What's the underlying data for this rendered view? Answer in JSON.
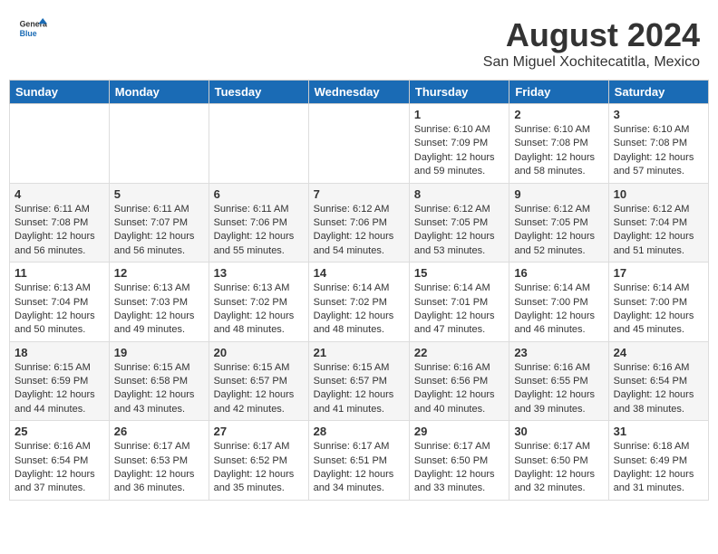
{
  "logo": {
    "line1": "General",
    "line2": "Blue"
  },
  "title": "August 2024",
  "subtitle": "San Miguel Xochitecatitla, Mexico",
  "days_of_week": [
    "Sunday",
    "Monday",
    "Tuesday",
    "Wednesday",
    "Thursday",
    "Friday",
    "Saturday"
  ],
  "weeks": [
    [
      {
        "day": "",
        "info": ""
      },
      {
        "day": "",
        "info": ""
      },
      {
        "day": "",
        "info": ""
      },
      {
        "day": "",
        "info": ""
      },
      {
        "day": "1",
        "info": "Sunrise: 6:10 AM\nSunset: 7:09 PM\nDaylight: 12 hours\nand 59 minutes."
      },
      {
        "day": "2",
        "info": "Sunrise: 6:10 AM\nSunset: 7:08 PM\nDaylight: 12 hours\nand 58 minutes."
      },
      {
        "day": "3",
        "info": "Sunrise: 6:10 AM\nSunset: 7:08 PM\nDaylight: 12 hours\nand 57 minutes."
      }
    ],
    [
      {
        "day": "4",
        "info": "Sunrise: 6:11 AM\nSunset: 7:08 PM\nDaylight: 12 hours\nand 56 minutes."
      },
      {
        "day": "5",
        "info": "Sunrise: 6:11 AM\nSunset: 7:07 PM\nDaylight: 12 hours\nand 56 minutes."
      },
      {
        "day": "6",
        "info": "Sunrise: 6:11 AM\nSunset: 7:06 PM\nDaylight: 12 hours\nand 55 minutes."
      },
      {
        "day": "7",
        "info": "Sunrise: 6:12 AM\nSunset: 7:06 PM\nDaylight: 12 hours\nand 54 minutes."
      },
      {
        "day": "8",
        "info": "Sunrise: 6:12 AM\nSunset: 7:05 PM\nDaylight: 12 hours\nand 53 minutes."
      },
      {
        "day": "9",
        "info": "Sunrise: 6:12 AM\nSunset: 7:05 PM\nDaylight: 12 hours\nand 52 minutes."
      },
      {
        "day": "10",
        "info": "Sunrise: 6:12 AM\nSunset: 7:04 PM\nDaylight: 12 hours\nand 51 minutes."
      }
    ],
    [
      {
        "day": "11",
        "info": "Sunrise: 6:13 AM\nSunset: 7:04 PM\nDaylight: 12 hours\nand 50 minutes."
      },
      {
        "day": "12",
        "info": "Sunrise: 6:13 AM\nSunset: 7:03 PM\nDaylight: 12 hours\nand 49 minutes."
      },
      {
        "day": "13",
        "info": "Sunrise: 6:13 AM\nSunset: 7:02 PM\nDaylight: 12 hours\nand 48 minutes."
      },
      {
        "day": "14",
        "info": "Sunrise: 6:14 AM\nSunset: 7:02 PM\nDaylight: 12 hours\nand 48 minutes."
      },
      {
        "day": "15",
        "info": "Sunrise: 6:14 AM\nSunset: 7:01 PM\nDaylight: 12 hours\nand 47 minutes."
      },
      {
        "day": "16",
        "info": "Sunrise: 6:14 AM\nSunset: 7:00 PM\nDaylight: 12 hours\nand 46 minutes."
      },
      {
        "day": "17",
        "info": "Sunrise: 6:14 AM\nSunset: 7:00 PM\nDaylight: 12 hours\nand 45 minutes."
      }
    ],
    [
      {
        "day": "18",
        "info": "Sunrise: 6:15 AM\nSunset: 6:59 PM\nDaylight: 12 hours\nand 44 minutes."
      },
      {
        "day": "19",
        "info": "Sunrise: 6:15 AM\nSunset: 6:58 PM\nDaylight: 12 hours\nand 43 minutes."
      },
      {
        "day": "20",
        "info": "Sunrise: 6:15 AM\nSunset: 6:57 PM\nDaylight: 12 hours\nand 42 minutes."
      },
      {
        "day": "21",
        "info": "Sunrise: 6:15 AM\nSunset: 6:57 PM\nDaylight: 12 hours\nand 41 minutes."
      },
      {
        "day": "22",
        "info": "Sunrise: 6:16 AM\nSunset: 6:56 PM\nDaylight: 12 hours\nand 40 minutes."
      },
      {
        "day": "23",
        "info": "Sunrise: 6:16 AM\nSunset: 6:55 PM\nDaylight: 12 hours\nand 39 minutes."
      },
      {
        "day": "24",
        "info": "Sunrise: 6:16 AM\nSunset: 6:54 PM\nDaylight: 12 hours\nand 38 minutes."
      }
    ],
    [
      {
        "day": "25",
        "info": "Sunrise: 6:16 AM\nSunset: 6:54 PM\nDaylight: 12 hours\nand 37 minutes."
      },
      {
        "day": "26",
        "info": "Sunrise: 6:17 AM\nSunset: 6:53 PM\nDaylight: 12 hours\nand 36 minutes."
      },
      {
        "day": "27",
        "info": "Sunrise: 6:17 AM\nSunset: 6:52 PM\nDaylight: 12 hours\nand 35 minutes."
      },
      {
        "day": "28",
        "info": "Sunrise: 6:17 AM\nSunset: 6:51 PM\nDaylight: 12 hours\nand 34 minutes."
      },
      {
        "day": "29",
        "info": "Sunrise: 6:17 AM\nSunset: 6:50 PM\nDaylight: 12 hours\nand 33 minutes."
      },
      {
        "day": "30",
        "info": "Sunrise: 6:17 AM\nSunset: 6:50 PM\nDaylight: 12 hours\nand 32 minutes."
      },
      {
        "day": "31",
        "info": "Sunrise: 6:18 AM\nSunset: 6:49 PM\nDaylight: 12 hours\nand 31 minutes."
      }
    ]
  ]
}
